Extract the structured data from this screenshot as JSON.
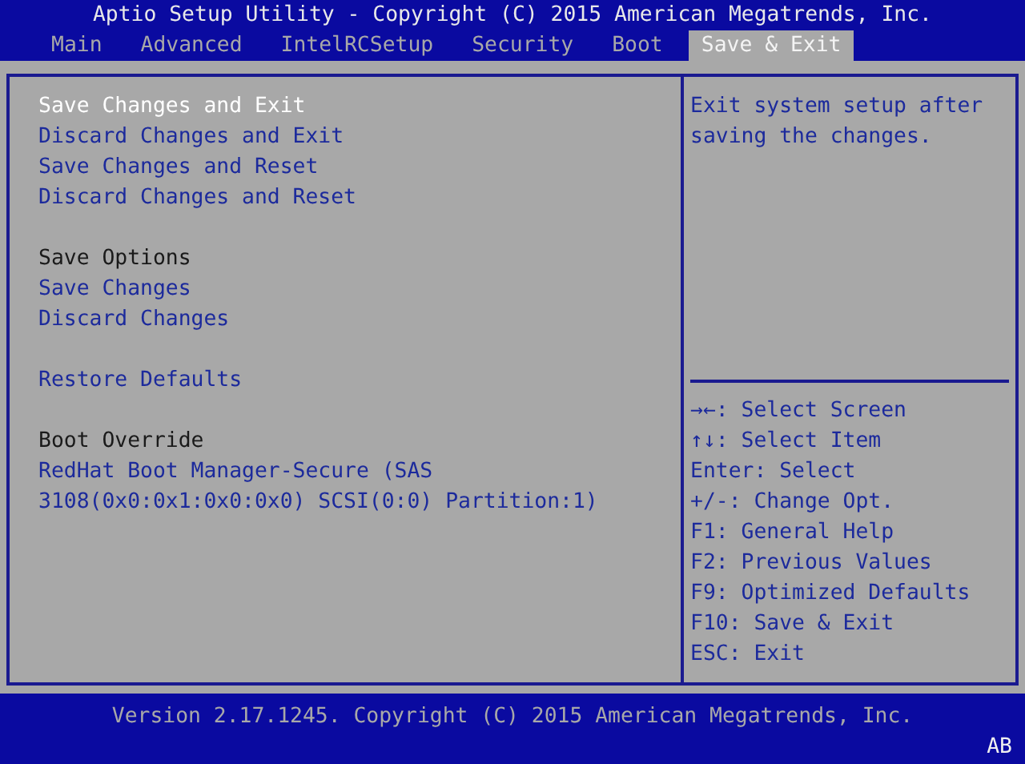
{
  "title": "Aptio Setup Utility - Copyright (C) 2015 American Megatrends, Inc.",
  "tabs": [
    {
      "label": "Main",
      "selected": false
    },
    {
      "label": "Advanced",
      "selected": false
    },
    {
      "label": "IntelRCSetup",
      "selected": false
    },
    {
      "label": "Security",
      "selected": false
    },
    {
      "label": "Boot",
      "selected": false
    },
    {
      "label": "Save & Exit",
      "selected": true
    }
  ],
  "menu": {
    "groups": [
      {
        "items": [
          {
            "kind": "action",
            "lines": [
              "Save Changes and Exit"
            ],
            "selected": true
          },
          {
            "kind": "action",
            "lines": [
              "Discard Changes and Exit"
            ],
            "selected": false
          },
          {
            "kind": "action",
            "lines": [
              "Save Changes and Reset"
            ],
            "selected": false
          },
          {
            "kind": "action",
            "lines": [
              "Discard Changes and Reset"
            ],
            "selected": false
          }
        ]
      },
      {
        "items": [
          {
            "kind": "heading",
            "lines": [
              "Save Options"
            ]
          },
          {
            "kind": "action",
            "lines": [
              "Save Changes"
            ],
            "selected": false
          },
          {
            "kind": "action",
            "lines": [
              "Discard Changes"
            ],
            "selected": false
          }
        ]
      },
      {
        "items": [
          {
            "kind": "action",
            "lines": [
              "Restore Defaults"
            ],
            "selected": false
          }
        ]
      },
      {
        "items": [
          {
            "kind": "heading",
            "lines": [
              "Boot Override"
            ]
          },
          {
            "kind": "action",
            "lines": [
              "RedHat Boot Manager-Secure (SAS",
              "3108(0x0:0x1:0x0:0x0) SCSI(0:0) Partition:1)"
            ],
            "selected": false
          }
        ]
      }
    ]
  },
  "help": {
    "description": "Exit system setup after saving the changes.",
    "keys": [
      "→←: Select Screen",
      "↑↓: Select Item",
      "Enter: Select",
      "+/-: Change Opt.",
      "F1: General Help",
      "F2: Previous Values",
      "F9: Optimized Defaults",
      "F10: Save & Exit",
      "ESC: Exit"
    ]
  },
  "footer": {
    "version": "Version 2.17.1245. Copyright (C) 2015 American Megatrends, Inc.",
    "indicator": "AB"
  }
}
